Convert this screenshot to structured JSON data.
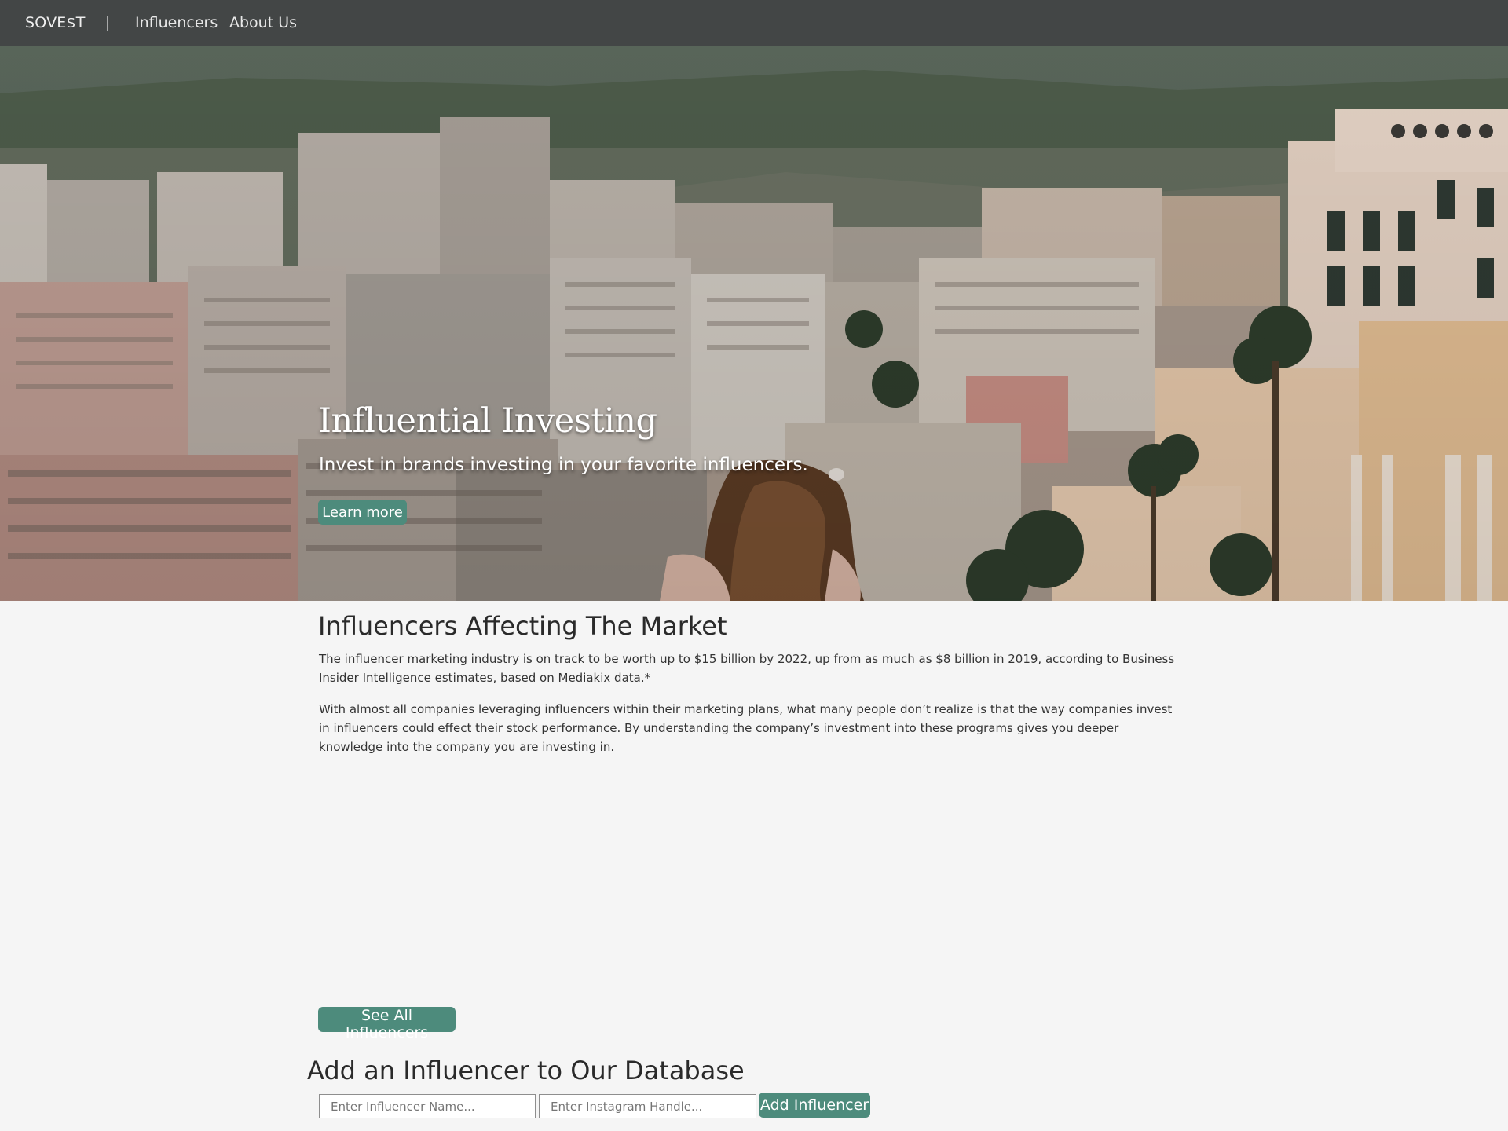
{
  "nav": {
    "brand": "SOVE$T",
    "separator": "|",
    "links": [
      "Influencers",
      "About Us"
    ]
  },
  "hero": {
    "title": "Influential Investing",
    "subtitle": "Invest in brands investing in your favorite influencers.",
    "cta_label": "Learn more"
  },
  "market": {
    "title": "Influencers Affecting The Market",
    "paragraphs": [
      "The influencer marketing industry is on track to be worth up to $15 billion by 2022, up from as much as $8 billion in 2019, according to Business Insider Intelligence estimates, based on Mediakix data.*",
      "With almost all companies leveraging influencers within their marketing plans, what many people don’t realize is that the way companies invest in influencers could effect their stock performance. By understanding the company’s investment into these programs gives you deeper knowledge into the company you are investing in."
    ],
    "see_all_label": "See All Influencers"
  },
  "add_form": {
    "title": "Add an Influencer to Our Database",
    "name_placeholder": "Enter Influencer Name...",
    "handle_placeholder": "Enter Instagram Handle...",
    "name_value": "",
    "handle_value": "",
    "submit_label": "Add Influencer"
  },
  "colors": {
    "nav_bg": "#434646",
    "accent": "#4d8b7c",
    "page_bg": "#f5f5f5"
  }
}
